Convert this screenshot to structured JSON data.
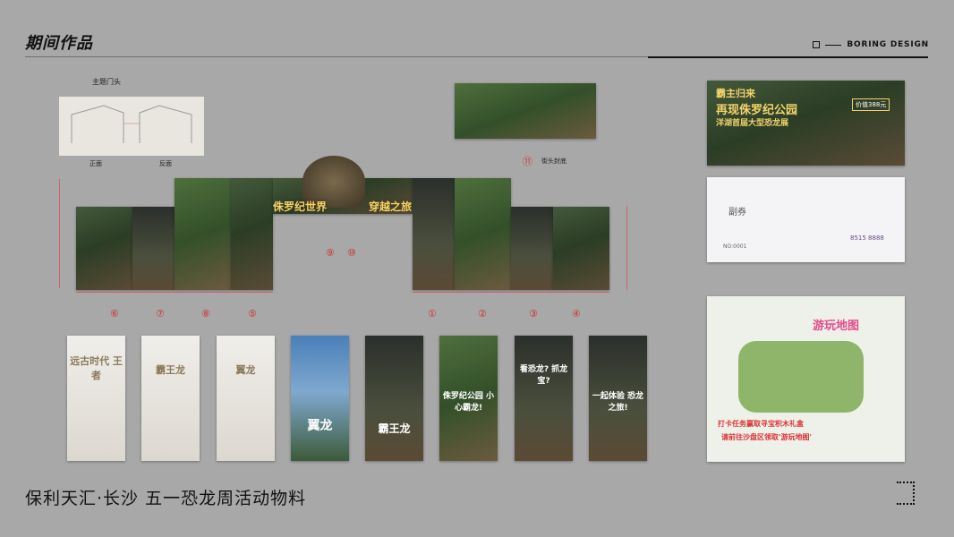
{
  "header": {
    "title": "期间作品",
    "brand": "BORING DESIGN"
  },
  "sketch": {
    "label": "主题门头",
    "front_label": "正面",
    "back_label": "反面"
  },
  "top_banner": {
    "number": "⑪",
    "label": "街头封底"
  },
  "arch": {
    "slogan_left": "侏罗纪世界",
    "slogan_right": "穿越之旅",
    "numbers": [
      "⑨",
      "⑩"
    ],
    "panel_numbers_left": [
      "⑥",
      "⑦",
      "⑧",
      "⑤"
    ],
    "panel_numbers_right": [
      "①",
      "②",
      "③",
      "④"
    ]
  },
  "posters": [
    {
      "main": "远古时代 王者",
      "theme": "white"
    },
    {
      "main": "霸王龙",
      "theme": "white"
    },
    {
      "main": "翼龙",
      "theme": "white"
    },
    {
      "main": "翼龙",
      "theme": "blue"
    },
    {
      "main": "霸王龙",
      "theme": "dark"
    },
    {
      "main": "侏罗纪公园 小心霸龙!",
      "theme": "green"
    },
    {
      "main": "看恐龙? 抓龙宝?",
      "theme": "dark"
    },
    {
      "main": "一起体验 恐龙之旅!",
      "theme": "dark"
    }
  ],
  "right_cards": {
    "ad_banner": {
      "line1": "霸主归来",
      "line2": "再现侏罗纪公园",
      "line3": "洋湖首届大型恐龙展",
      "price": "价值388元"
    },
    "ticket": {
      "label": "副券",
      "phone": "8515 8888",
      "no": "NO:0001"
    },
    "map": {
      "title": "游玩地图",
      "caption1": "打卡任务赢取寻宝积木礼盒",
      "caption2": "请前往沙盘区领取'游玩地图'"
    }
  },
  "footer": {
    "text": "保利天汇·长沙  五一恐龙周活动物料"
  }
}
